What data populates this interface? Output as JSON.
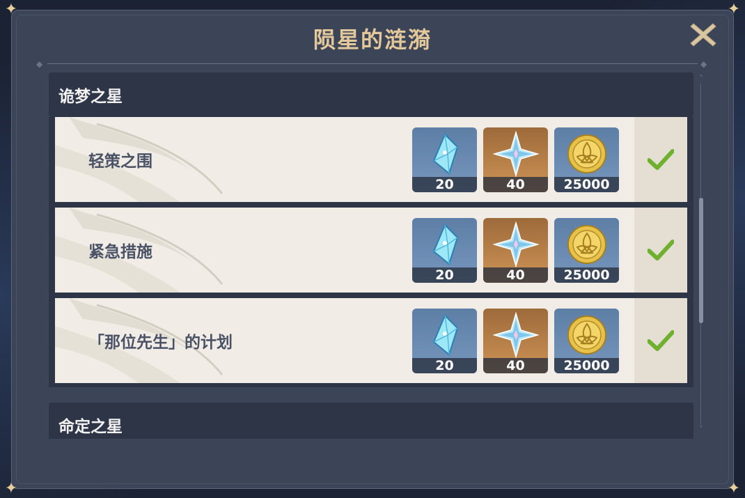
{
  "window": {
    "title": "陨星的涟漪"
  },
  "sections": [
    {
      "header": "诡梦之星",
      "rows": [
        {
          "name": "轻策之围",
          "rewards": [
            {
              "icon": "primogem-crystal-icon",
              "count": "20"
            },
            {
              "icon": "star-exp-icon",
              "count": "40"
            },
            {
              "icon": "mora-coin-icon",
              "count": "25000"
            }
          ],
          "completed_icon": "checkmark-icon"
        },
        {
          "name": "紧急措施",
          "rewards": [
            {
              "icon": "primogem-crystal-icon",
              "count": "20"
            },
            {
              "icon": "star-exp-icon",
              "count": "40"
            },
            {
              "icon": "mora-coin-icon",
              "count": "25000"
            }
          ],
          "completed_icon": "checkmark-icon"
        },
        {
          "name": "「那位先生」的计划",
          "rewards": [
            {
              "icon": "primogem-crystal-icon",
              "count": "20"
            },
            {
              "icon": "star-exp-icon",
              "count": "40"
            },
            {
              "icon": "mora-coin-icon",
              "count": "25000"
            }
          ],
          "completed_icon": "checkmark-icon"
        }
      ]
    },
    {
      "header": "命定之星",
      "rows": []
    }
  ],
  "colors": {
    "title": "#e2c89a",
    "panel": "#3c4558",
    "row_bg": "#f1ede6",
    "check": "#6fb02f",
    "blue_tile": "#6d8db4",
    "gold_tile": "#c08548"
  }
}
